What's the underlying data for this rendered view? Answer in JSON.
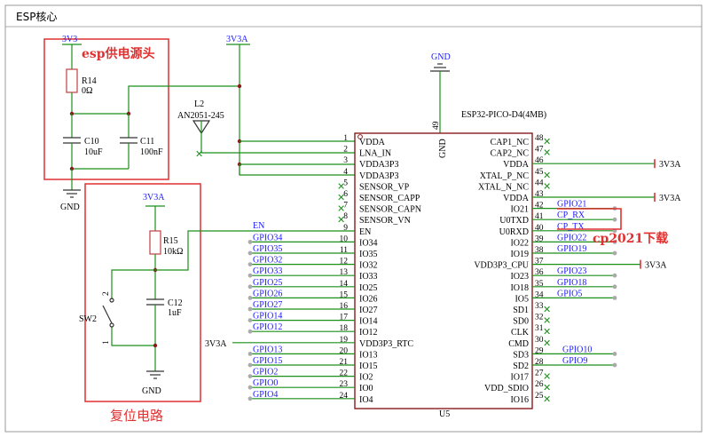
{
  "sheet_title": "ESP核心",
  "power_section": {
    "title": "esp供电源头",
    "supply": "3V3",
    "resistor": {
      "ref": "R14",
      "value": "0Ω"
    },
    "c10": {
      "ref": "C10",
      "value": "10uF"
    },
    "c11": {
      "ref": "C11",
      "value": "100nF"
    },
    "gnd": "GND"
  },
  "antenna": {
    "ref": "L2",
    "part": "AN2051-245"
  },
  "vcc_3v3a": "3V3A",
  "gnd_top": "GND",
  "chip": {
    "part": "ESP32-PICO-D4(4MB)",
    "ref": "U5",
    "gnd_pin_label": "GND",
    "gnd_pin_num": "49",
    "left_pins": [
      {
        "num": "1",
        "name": "VDDA"
      },
      {
        "num": "2",
        "name": "LNA_IN"
      },
      {
        "num": "3",
        "name": "VDDA3P3"
      },
      {
        "num": "4",
        "name": "VDDA3P3"
      },
      {
        "num": "5",
        "name": "SENSOR_VP"
      },
      {
        "num": "6",
        "name": "SENSOR_CAPP"
      },
      {
        "num": "7",
        "name": "SENSOR_CAPN"
      },
      {
        "num": "8",
        "name": "SENSOR_VN"
      },
      {
        "num": "9",
        "name": "EN"
      },
      {
        "num": "10",
        "name": "IO34"
      },
      {
        "num": "11",
        "name": "IO35"
      },
      {
        "num": "12",
        "name": "IO32"
      },
      {
        "num": "13",
        "name": "IO33"
      },
      {
        "num": "14",
        "name": "IO25"
      },
      {
        "num": "15",
        "name": "IO26"
      },
      {
        "num": "16",
        "name": "IO27"
      },
      {
        "num": "17",
        "name": "IO14"
      },
      {
        "num": "18",
        "name": "IO12"
      },
      {
        "num": "19",
        "name": "VDD3P3_RTC"
      },
      {
        "num": "20",
        "name": "IO13"
      },
      {
        "num": "21",
        "name": "IO15"
      },
      {
        "num": "22",
        "name": "IO2"
      },
      {
        "num": "23",
        "name": "IO0"
      },
      {
        "num": "24",
        "name": "IO4"
      }
    ],
    "right_pins": [
      {
        "num": "48",
        "name": "CAP1_NC"
      },
      {
        "num": "47",
        "name": "CAP2_NC"
      },
      {
        "num": "46",
        "name": "VDDA"
      },
      {
        "num": "45",
        "name": "XTAL_P_NC"
      },
      {
        "num": "44",
        "name": "XTAL_N_NC"
      },
      {
        "num": "43",
        "name": "VDDA"
      },
      {
        "num": "42",
        "name": "IO21"
      },
      {
        "num": "41",
        "name": "U0TXD"
      },
      {
        "num": "40",
        "name": "U0RXD"
      },
      {
        "num": "39",
        "name": "IO22"
      },
      {
        "num": "38",
        "name": "IO19"
      },
      {
        "num": "37",
        "name": "VDD3P3_CPU"
      },
      {
        "num": "36",
        "name": "IO23"
      },
      {
        "num": "35",
        "name": "IO18"
      },
      {
        "num": "34",
        "name": "IO5"
      },
      {
        "num": "33",
        "name": "SD1"
      },
      {
        "num": "32",
        "name": "SD0"
      },
      {
        "num": "31",
        "name": "CLK"
      },
      {
        "num": "30",
        "name": "CMD"
      },
      {
        "num": "29",
        "name": "SD3"
      },
      {
        "num": "28",
        "name": "SD2"
      },
      {
        "num": "27",
        "name": "IO17"
      },
      {
        "num": "26",
        "name": "VDD_SDIO"
      },
      {
        "num": "25",
        "name": "IO16"
      }
    ]
  },
  "left_nets": [
    "EN",
    "GPIO34",
    "GPIO35",
    "GPIO32",
    "GPIO33",
    "GPIO25",
    "GPIO26",
    "GPIO27",
    "GPIO14",
    "GPIO12",
    "3V3A",
    "GPIO13",
    "GPIO15",
    "GPIO2",
    "GPIO0",
    "GPIO4"
  ],
  "right_nets": {
    "vdda46": "3V3A",
    "vdda43": "3V3A",
    "io21": "GPIO21",
    "tx": "CP_RX",
    "rx": "CP_TX",
    "io22": "GPIO22",
    "io19": "GPIO19",
    "cpu": "3V3A",
    "io23": "GPIO23",
    "io18": "GPIO18",
    "io5": "GPIO5",
    "sd3": "GPIO10",
    "sd2": "GPIO9"
  },
  "download_label": "cp2021下载",
  "reset_section": {
    "title": "复位电路",
    "supply": "3V3A",
    "resistor": {
      "ref": "R15",
      "value": "10kΩ"
    },
    "cap": {
      "ref": "C12",
      "value": "1uF"
    },
    "switch": "SW2",
    "pin1": "1",
    "pin2": "2",
    "gnd": "GND"
  }
}
